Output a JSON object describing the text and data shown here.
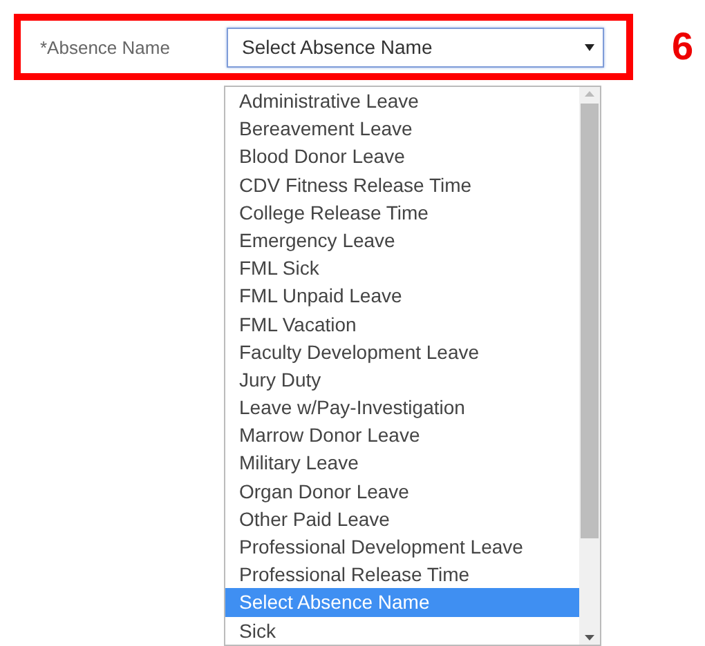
{
  "field": {
    "label": "*Absence Name",
    "value": "Select Absence Name",
    "expanded": true
  },
  "callout": "6",
  "options": [
    {
      "label": "Administrative Leave",
      "selected": false
    },
    {
      "label": "Bereavement Leave",
      "selected": false
    },
    {
      "label": "Blood Donor Leave",
      "selected": false
    },
    {
      "label": "CDV Fitness Release Time",
      "selected": false
    },
    {
      "label": "College Release Time",
      "selected": false
    },
    {
      "label": "Emergency Leave",
      "selected": false
    },
    {
      "label": "FML Sick",
      "selected": false
    },
    {
      "label": "FML Unpaid Leave",
      "selected": false
    },
    {
      "label": "FML Vacation",
      "selected": false
    },
    {
      "label": "Faculty Development Leave",
      "selected": false
    },
    {
      "label": "Jury Duty",
      "selected": false
    },
    {
      "label": "Leave w/Pay-Investigation",
      "selected": false
    },
    {
      "label": "Marrow Donor Leave",
      "selected": false
    },
    {
      "label": "Military Leave",
      "selected": false
    },
    {
      "label": "Organ Donor Leave",
      "selected": false
    },
    {
      "label": "Other Paid Leave",
      "selected": false
    },
    {
      "label": "Professional Development Leave",
      "selected": false
    },
    {
      "label": "Professional Release Time",
      "selected": false
    },
    {
      "label": "Select Absence Name",
      "selected": true
    },
    {
      "label": "Sick",
      "selected": false
    }
  ]
}
